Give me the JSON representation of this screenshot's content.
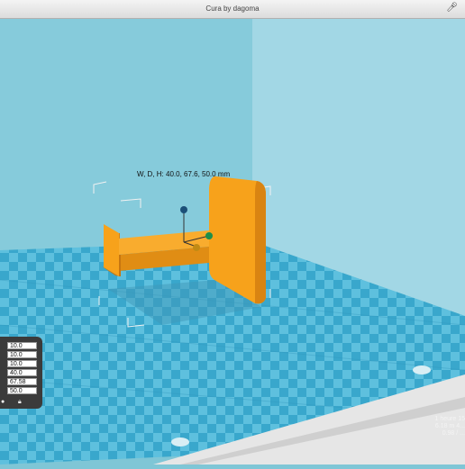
{
  "window": {
    "title": "Cura by dagoma"
  },
  "viewport": {
    "dimensions_label": "W, D, H: 40.0, 67.6, 50.0 mm"
  },
  "scale_panel": {
    "values": [
      "10.0",
      "10.0",
      "10.0",
      "40.0",
      "67.58",
      "50.0"
    ]
  },
  "print_info": {
    "lines": [
      "1 heure 15",
      "6.18 m 4...",
      "0.98 / ..."
    ]
  },
  "colors": {
    "sky": "#7fc6d6",
    "grid_light": "#5ec0de",
    "grid_dark": "#39a7cc",
    "object": "#f7a21b"
  }
}
